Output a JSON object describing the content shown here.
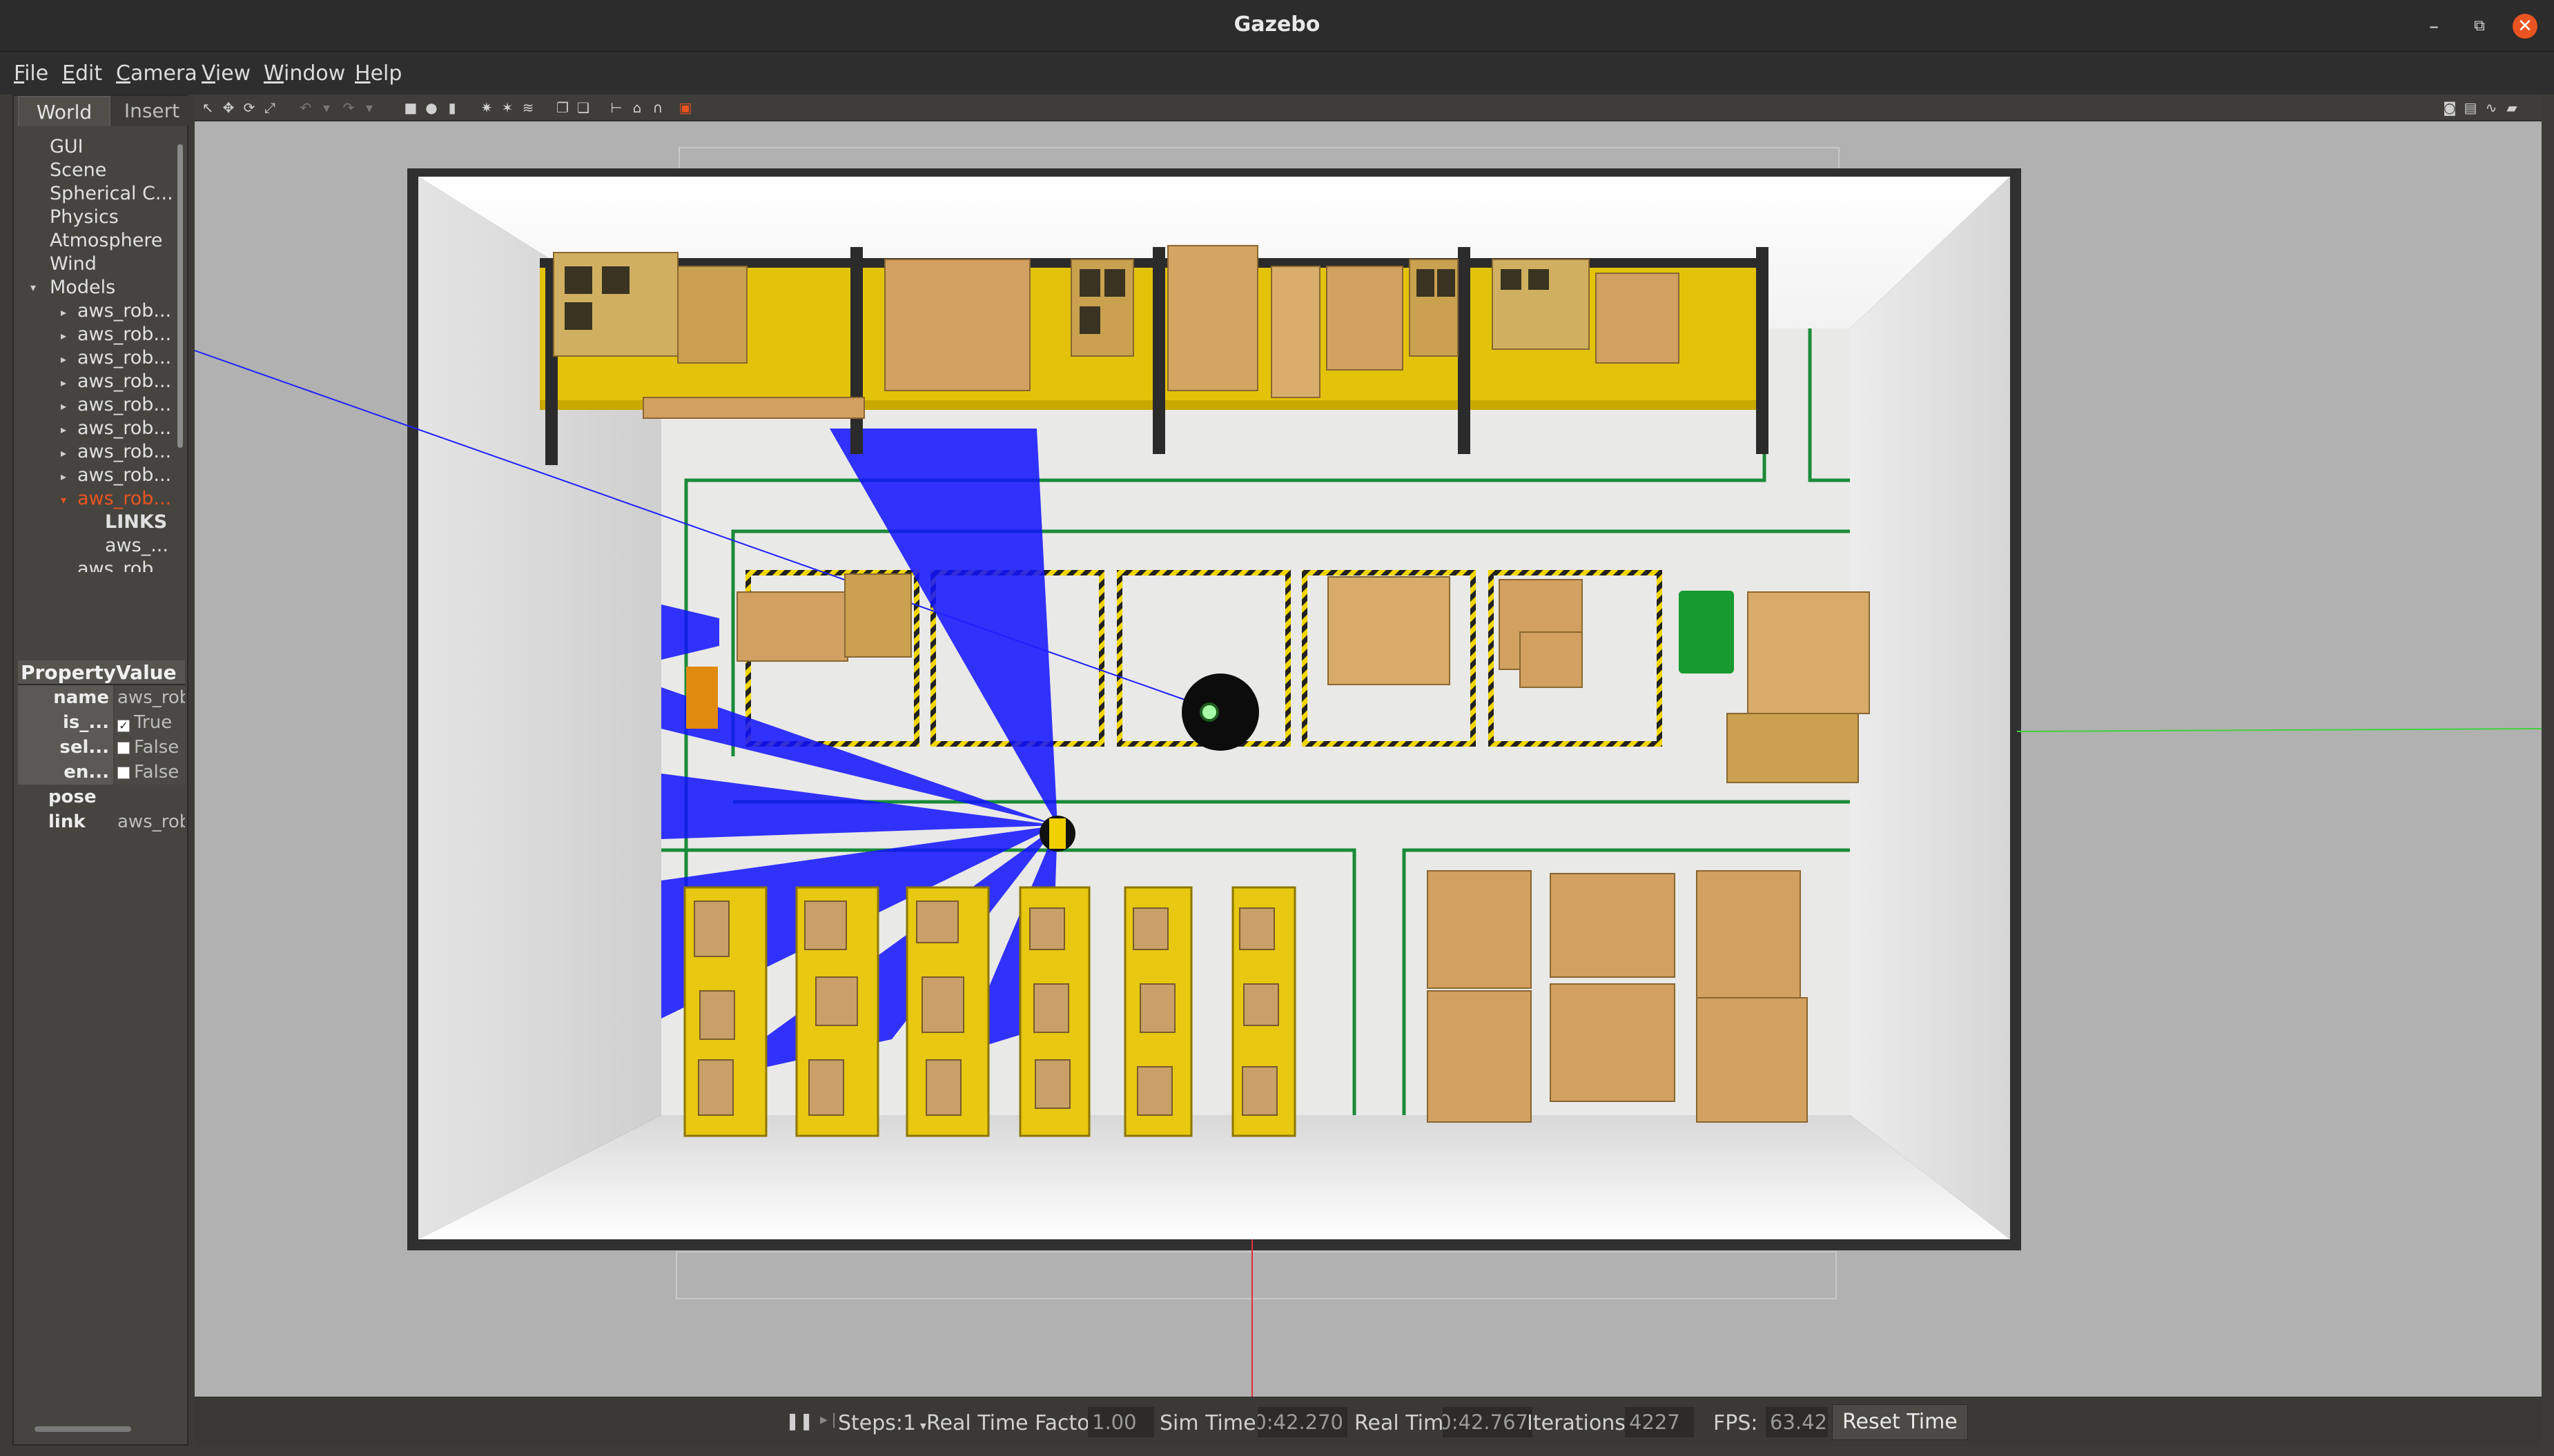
{
  "window": {
    "title": "Gazebo"
  },
  "menu": [
    {
      "label": "File",
      "u": "F",
      "rest": "ile"
    },
    {
      "label": "Edit",
      "u": "E",
      "rest": "dit"
    },
    {
      "label": "Camera",
      "u": "C",
      "rest": "amera"
    },
    {
      "label": "View",
      "u": "V",
      "rest": "iew"
    },
    {
      "label": "Window",
      "u": "W",
      "rest": "indow"
    },
    {
      "label": "Help",
      "u": "H",
      "rest": "elp"
    }
  ],
  "left_panel": {
    "tabs": {
      "world": "World",
      "insert": "Insert"
    },
    "tree": {
      "gui": "GUI",
      "scene": "Scene",
      "spherical": "Spherical C...",
      "physics": "Physics",
      "atmosphere": "Atmosphere",
      "wind": "Wind",
      "models": "Models",
      "model_items": [
        "aws_rob...",
        "aws_rob...",
        "aws_rob...",
        "aws_rob...",
        "aws_rob...",
        "aws_rob...",
        "aws_rob...",
        "aws_rob..."
      ],
      "selected_model": "aws_rob...",
      "links_header": "LINKS",
      "link_item": "aws_...",
      "partial_item": "aws_rob..."
    },
    "properties": {
      "header_property": "Property",
      "header_value": "Value",
      "rows": [
        {
          "key": "name",
          "value": "aws_robo"
        },
        {
          "key": "is_...",
          "value": "True",
          "checked": true
        },
        {
          "key": "sel...",
          "value": "False",
          "checked": false
        },
        {
          "key": "en...",
          "value": "False",
          "checked": false
        }
      ],
      "groups": [
        {
          "key": "pose",
          "value": ""
        },
        {
          "key": "link",
          "value": "aws_robo"
        }
      ]
    }
  },
  "status": {
    "steps_label": "Steps:",
    "steps_value": "1",
    "rtf_label": "Real Time Factor:",
    "rtf_value": "1.00",
    "sim_time_label": "Sim Time:",
    "sim_time_value": "0:42.270",
    "real_time_label": "Real Time:",
    "real_time_value": "0:42.767",
    "iterations_label": "Iterations:",
    "iterations_value": "4227",
    "fps_label": "FPS:",
    "fps_value": "63.42",
    "reset_label": "Reset Time"
  },
  "colors": {
    "accent": "#e95420",
    "lidar": "#1010ff",
    "shelf_yellow": "#e0c010",
    "box": "#d2a060",
    "floor_line": "#1a8a3a"
  }
}
